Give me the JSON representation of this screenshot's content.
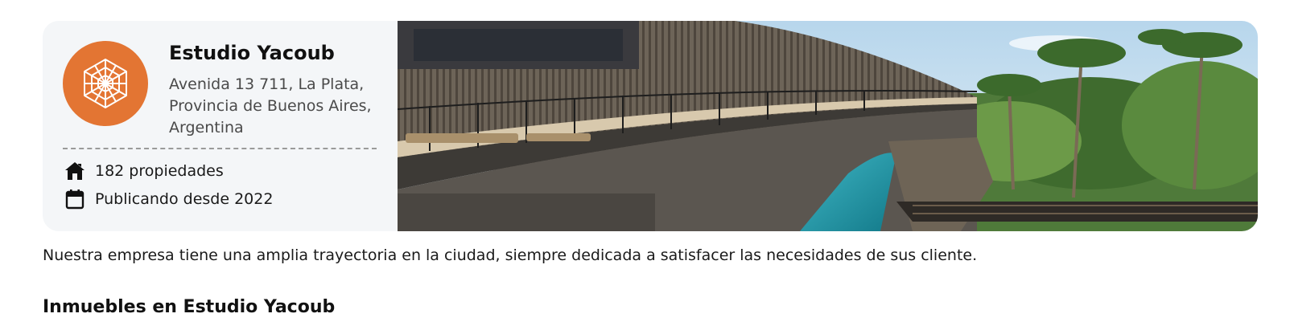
{
  "agency": {
    "name": "Estudio Yacoub",
    "address": "Avenida 13 711, La Plata, Provincia de Buenos Aires, Argentina",
    "logo_icon": "hexagon-lattice-icon",
    "accent_color": "#e37533"
  },
  "stats": {
    "properties": "182 propiedades",
    "properties_icon": "house-icon",
    "since": "Publicando desde 2022",
    "since_icon": "calendar-icon"
  },
  "description": "Nuestra empresa tiene una amplia trayectoria en la ciudad, siempre dedicada a satisfacer las necesidades de sus cliente.",
  "section": {
    "title": "Inmuebles en Estudio Yacoub"
  }
}
